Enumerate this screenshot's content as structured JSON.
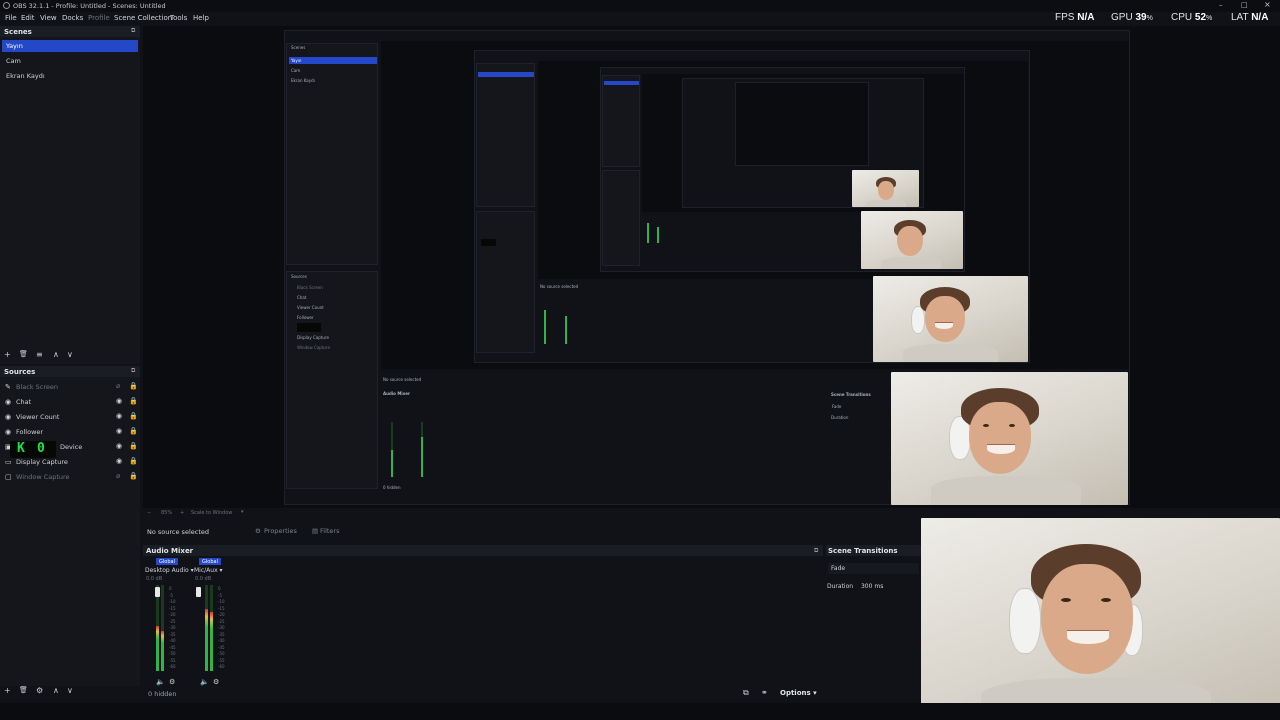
{
  "window": {
    "title": "OBS 32.1.1 - Profile: Untitled - Scenes: Untitled",
    "minimize": "–",
    "maximize": "□",
    "close": "×"
  },
  "menu": [
    "File",
    "Edit",
    "View",
    "Docks",
    "Profile",
    "Scene Collection",
    "Tools",
    "Help"
  ],
  "stats": {
    "fps_label": "FPS",
    "fps_value": "N/A",
    "gpu_label": "GPU",
    "gpu_value": "39",
    "cpu_label": "CPU",
    "cpu_value": "52",
    "lat_label": "LAT",
    "lat_value": "N/A",
    "percent": "%"
  },
  "scenes": {
    "title": "Scenes",
    "items": [
      "Yayın",
      "Cam",
      "Ekran Kaydı"
    ],
    "selected_index": 0
  },
  "sources": {
    "title": "Sources",
    "items": [
      {
        "label": "Black Screen",
        "icon": "brush-icon",
        "visible": false
      },
      {
        "label": "Chat",
        "icon": "globe-icon",
        "visible": true
      },
      {
        "label": "Viewer Count",
        "icon": "globe-icon",
        "visible": true
      },
      {
        "label": "Follower",
        "icon": "globe-icon",
        "visible": true
      },
      {
        "label": "Device",
        "icon": "camera-icon",
        "visible": true
      },
      {
        "label": "Display Capture",
        "icon": "monitor-icon",
        "visible": true
      },
      {
        "label": "Window Capture",
        "icon": "window-icon",
        "visible": false
      }
    ],
    "overlay_keys": [
      "K",
      "0"
    ]
  },
  "toolbar_glyphs": {
    "add": "+",
    "remove": "🗑",
    "filter": "≡",
    "up": "∧",
    "down": "∨",
    "gear": "⚙",
    "collapse": "⧉"
  },
  "context": {
    "no_source": "No source selected",
    "properties": "Properties",
    "filters": "Filters"
  },
  "preview_status": {
    "zoom": "85%",
    "scale": "Scale to Window"
  },
  "mixer": {
    "title": "Audio Mixer",
    "channels": [
      {
        "badge": "Global",
        "name": "Desktop Audio",
        "db": "0.0 dB",
        "level": 0.52
      },
      {
        "badge": "Global",
        "name": "Mic/Aux",
        "db": "0.0 dB",
        "level": 0.72
      }
    ],
    "scale": [
      "0",
      "-5",
      "-10",
      "-15",
      "-20",
      "-25",
      "-30",
      "-35",
      "-40",
      "-45",
      "-50",
      "-55",
      "-60"
    ],
    "hidden": "0 hidden",
    "options": "Options"
  },
  "transitions": {
    "title": "Scene Transitions",
    "selected": "Fade",
    "duration_label": "Duration",
    "duration_value": "300 ms"
  },
  "colors": {
    "accent": "#2448c7",
    "meter_green": "#2fb34a",
    "overlay_green": "#1fe04a",
    "background": "#101217"
  }
}
